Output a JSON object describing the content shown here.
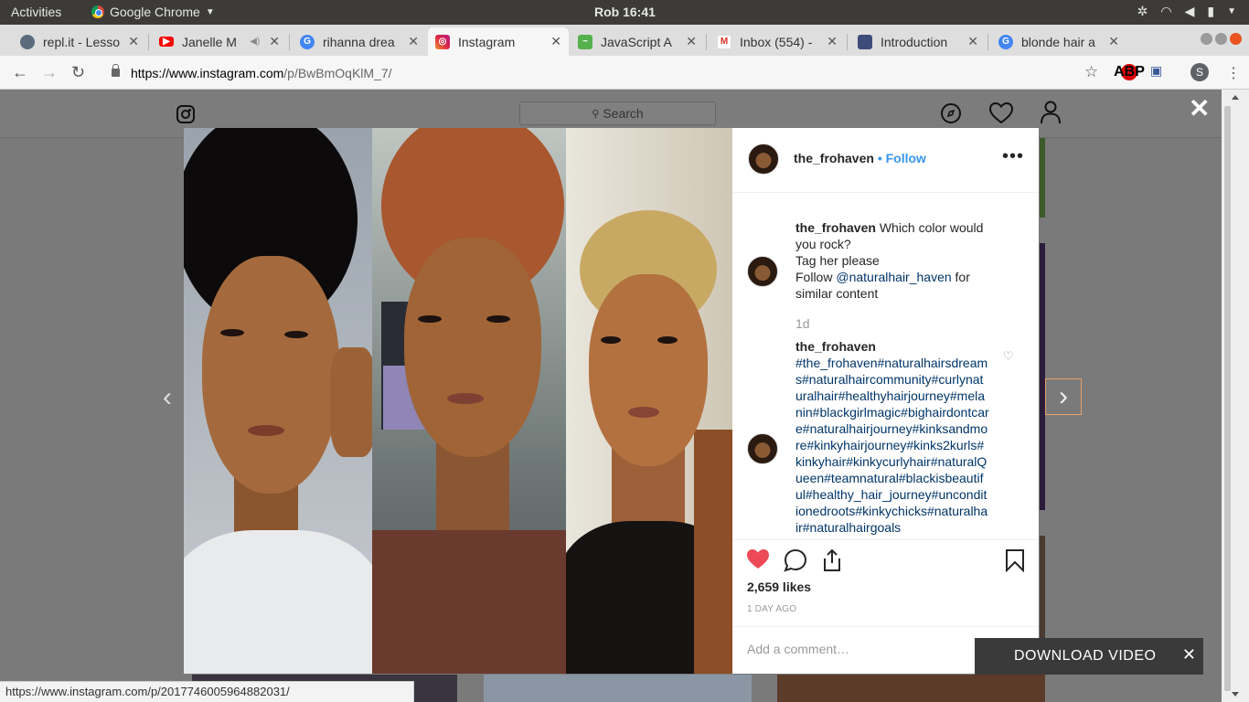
{
  "topbar": {
    "activities": "Activities",
    "app": "Google Chrome",
    "clock": "Rob 16:41"
  },
  "tabs": [
    {
      "label": "repl.it - Lesso",
      "favicon_color": "#5a6b7d"
    },
    {
      "label": "Janelle M",
      "favicon_color": "#ff0000"
    },
    {
      "label": "rihanna drea",
      "favicon_color": "#4285f4"
    },
    {
      "label": "Instagram",
      "favicon_color": "#c13584"
    },
    {
      "label": "JavaScript A",
      "favicon_color": "#56b04c"
    },
    {
      "label": "Inbox (554) -",
      "favicon_color": "#d93025"
    },
    {
      "label": "Introduction",
      "favicon_color": "#3e4c7a"
    },
    {
      "label": "blonde hair a",
      "favicon_color": "#4285f4"
    }
  ],
  "address": {
    "host": "https://www.instagram.com",
    "path": "/p/BwBmOqKlM_7/"
  },
  "extensions": {
    "abp": "ABP",
    "profile_initial": "S"
  },
  "ig": {
    "search_placeholder": "Search",
    "post": {
      "username": "the_frohaven",
      "follow": "• Follow",
      "caption_user": "the_frohaven",
      "caption_line1": "Which color would you rock?",
      "caption_line2": "Tag her please",
      "caption_follow_pre": "Follow ",
      "caption_mention": "@naturalhair_haven",
      "caption_follow_post": " for similar content",
      "caption_time": "1d",
      "comment_user": "the_frohaven",
      "comment_tags": "#the_frohaven#naturalhairsdreams#naturalhaircommunity#curlynaturalhair#healthyhairjourney#melanin#blackgirlmagic#bighairdontcare#naturalhairjourney#kinksandmore#kinkyhairjourney#kinks2kurls#kinkyhair#kinkycurlyhair#naturalQueen#teamnatural#blackisbeautiful#healthy_hair_journey#unconditionedroots#kinkychicks#naturalhair#naturalhairgoals",
      "likes": "2,659 likes",
      "posted": "1 DAY AGO",
      "comment_placeholder": "Add a comment…"
    }
  },
  "download": {
    "label": "DOWNLOAD VIDEO"
  },
  "status_url": "https://www.instagram.com/p/2017746005964882031/",
  "colors": {
    "like_red": "#ed4956",
    "link_blue": "#3897f0",
    "hashtag": "#003569"
  }
}
